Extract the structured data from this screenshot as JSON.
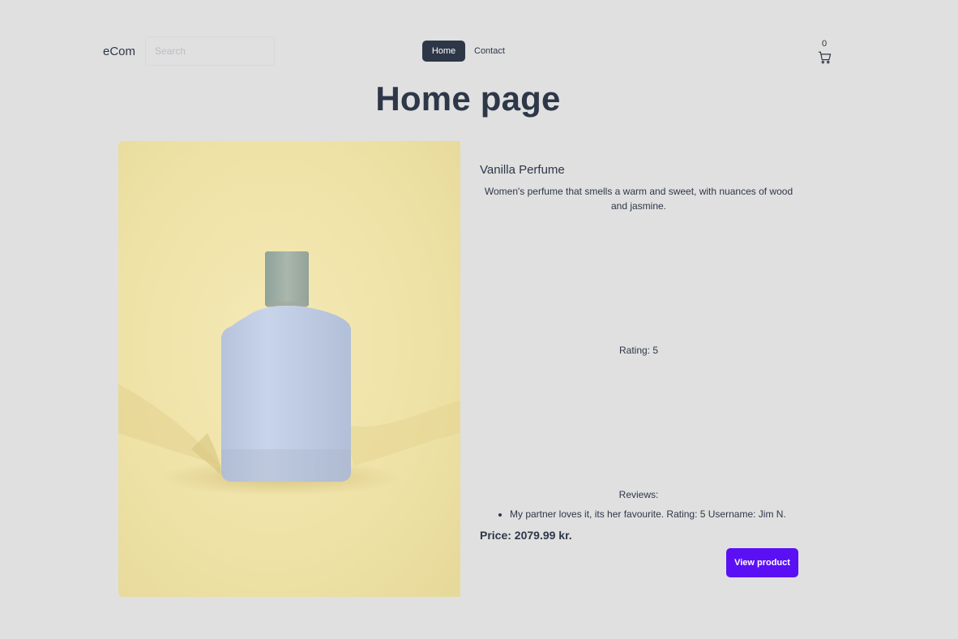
{
  "header": {
    "brand": "eCom",
    "search_placeholder": "Search",
    "nav": {
      "home": "Home",
      "contact": "Contact"
    },
    "cart_count": "0",
    "cart_icon": "shopping-cart-icon"
  },
  "page_title": "Home page",
  "product": {
    "image": "perfume-bottle-photo",
    "name": "Vanilla Perfume",
    "description": "Women's perfume that smells a warm and sweet, with nuances of wood and jasmine.",
    "rating": "Rating: 5",
    "reviews_label": "Reviews:",
    "reviews": [
      "My partner loves it, its her favourite. Rating: 5 Username: Jim N."
    ],
    "price": "Price: 2079.99 kr.",
    "view_button": "View product"
  },
  "colors": {
    "background": "#e0e0e0",
    "text": "#2d3748",
    "nav_active": "#2d3748",
    "primary_button": "#5b0ff5"
  }
}
